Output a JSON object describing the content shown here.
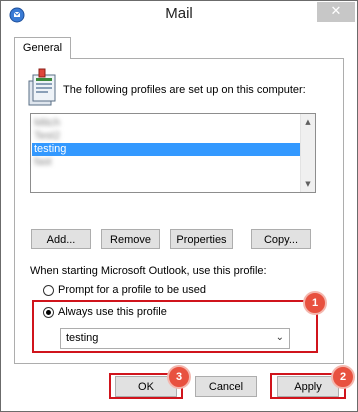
{
  "window": {
    "title": "Mail",
    "close_glyph": "✕"
  },
  "tabs": [
    {
      "label": "General"
    }
  ],
  "general": {
    "heading": "The following profiles are set up on this computer:",
    "profiles": [
      {
        "label": "Mitch",
        "obscured": true
      },
      {
        "label": "Test2",
        "obscured": true
      },
      {
        "label": "testing",
        "selected": true
      },
      {
        "label": "fast",
        "obscured": true
      }
    ],
    "buttons": {
      "add": "Add...",
      "remove": "Remove",
      "properties": "Properties",
      "copy": "Copy..."
    },
    "startup_label": "When starting Microsoft Outlook, use this profile:",
    "radio_prompt": "Prompt for a profile to be used",
    "radio_always": "Always use this profile",
    "selected_radio": "always",
    "dropdown_value": "testing"
  },
  "footer": {
    "ok": "OK",
    "cancel": "Cancel",
    "apply": "Apply"
  },
  "annotations": {
    "step1": "1",
    "step2": "2",
    "step3": "3",
    "highlight_color": "#d0141c",
    "badge_color": "#e8513f"
  }
}
